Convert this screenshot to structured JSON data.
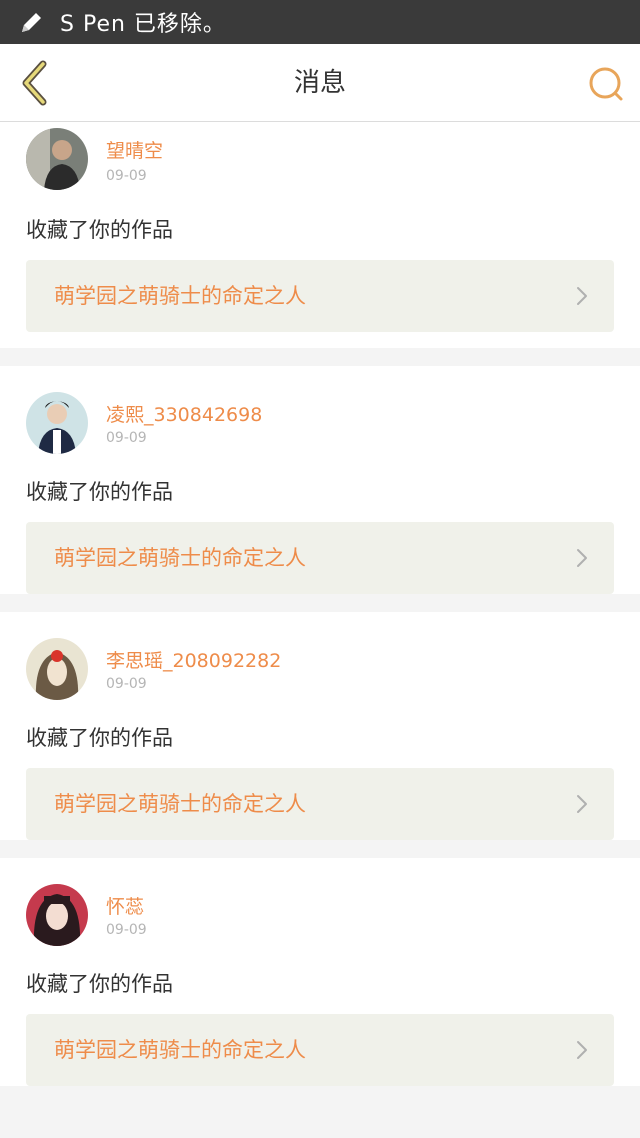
{
  "status_bar": {
    "text": "S Pen 已移除。",
    "icon": "pencil-icon"
  },
  "nav": {
    "title": "消息",
    "back_icon": "chevron-left-icon",
    "search_icon": "search-icon",
    "accent_color": "#e8a55a"
  },
  "messages": [
    {
      "username": "望晴空",
      "date": "09-09",
      "action": "收藏了你的作品",
      "work_title": "萌学园之萌骑士的命定之人"
    },
    {
      "username": "凌熙_330842698",
      "date": "09-09",
      "action": "收藏了你的作品",
      "work_title": "萌学园之萌骑士的命定之人"
    },
    {
      "username": "李思瑶_208092282",
      "date": "09-09",
      "action": "收藏了你的作品",
      "work_title": "萌学园之萌骑士的命定之人"
    },
    {
      "username": "怀蕊",
      "date": "09-09",
      "action": "收藏了你的作品",
      "work_title": "萌学园之萌骑士的命定之人"
    }
  ],
  "colors": {
    "accent": "#ee8c4a",
    "status_bar_bg": "#3a3a3a",
    "link_bg": "#f0f1ea",
    "page_bg": "#f4f4f4"
  }
}
